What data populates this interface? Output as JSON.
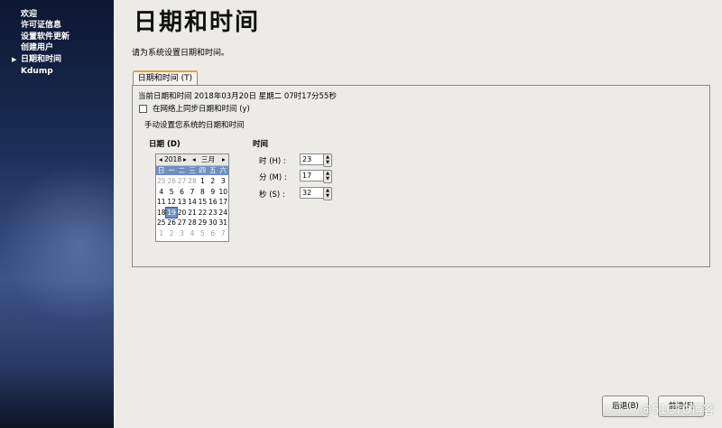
{
  "sidebar": {
    "items": [
      {
        "label": "欢迎"
      },
      {
        "label": "许可证信息"
      },
      {
        "label": "设置软件更新"
      },
      {
        "label": "创建用户"
      },
      {
        "label": "日期和时间",
        "active": true
      },
      {
        "label": "Kdump"
      }
    ]
  },
  "page": {
    "title": "日期和时间",
    "prompt": "请为系统设置日期和时间。"
  },
  "tab": {
    "label": "日期和时间 (T)"
  },
  "current": {
    "text": "当前日期和时间   2018年03月20日  星期二  07时17分55秒"
  },
  "ntp": {
    "label": "在网络上同步日期和时间 (y)",
    "checked": false
  },
  "manual": {
    "label": "手动设置您系统的日期和时间"
  },
  "date_section": {
    "label": "日期 (D)"
  },
  "time_section": {
    "label": "时间"
  },
  "calendar": {
    "prev_year": "◂",
    "year": "2018",
    "next_year": "▸",
    "prev_month": "◂",
    "month": "三月",
    "next_month": "▸",
    "weekdays": [
      "日",
      "一",
      "二",
      "三",
      "四",
      "五",
      "六"
    ],
    "weeks": [
      [
        "25",
        "26",
        "27",
        "28",
        "1",
        "2",
        "3"
      ],
      [
        "4",
        "5",
        "6",
        "7",
        "8",
        "9",
        "10"
      ],
      [
        "11",
        "12",
        "13",
        "14",
        "15",
        "16",
        "17"
      ],
      [
        "18",
        "19",
        "20",
        "21",
        "22",
        "23",
        "24"
      ],
      [
        "25",
        "26",
        "27",
        "28",
        "29",
        "30",
        "31"
      ],
      [
        "1",
        "2",
        "3",
        "4",
        "5",
        "6",
        "7"
      ]
    ],
    "selected": "19"
  },
  "time": {
    "hour_label": "时 (H) :",
    "hour": "23",
    "minute_label": "分 (M) :",
    "minute": "17",
    "second_label": "秒 (S) :",
    "second": "32"
  },
  "footer": {
    "back_label": "后退(B)",
    "forward_label": "前进(F)"
  },
  "watermark": "@51CTO博客",
  "colors": {
    "accent": "#e8a33a",
    "selection": "#6f8fc3",
    "sidebar": "#1c2e58"
  }
}
